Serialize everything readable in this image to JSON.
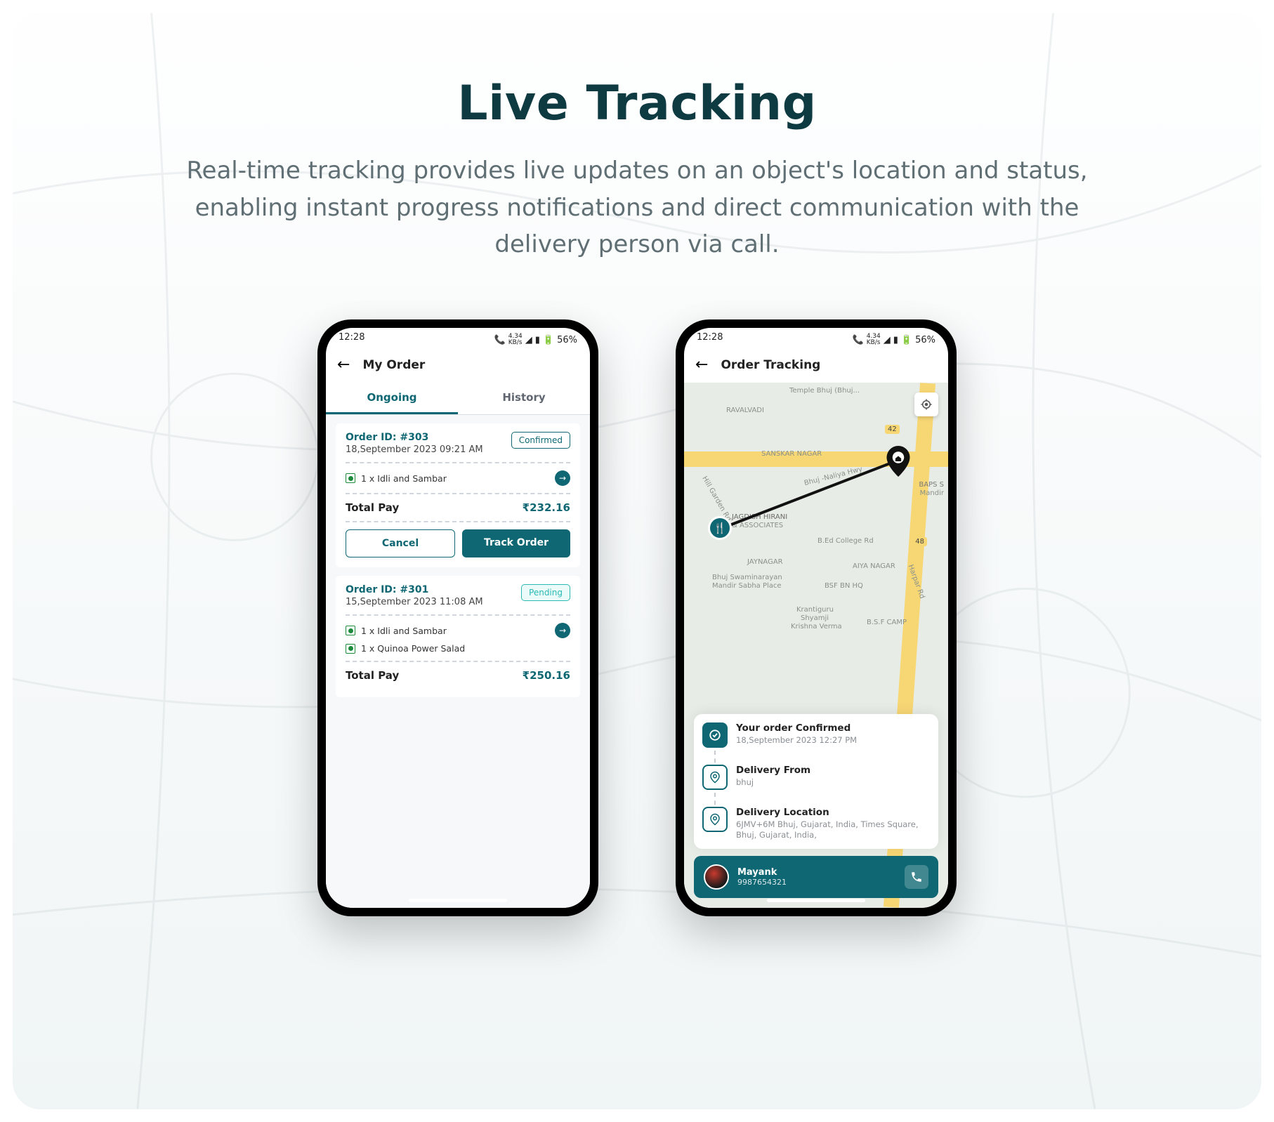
{
  "header": {
    "title": "Live Tracking",
    "subtitle": "Real-time tracking provides live updates on an object's location and status, enabling instant progress notifications and direct communication with the delivery person via call."
  },
  "status": {
    "time": "12:28",
    "net": "4.34",
    "net_unit": "KB/s",
    "battery": "56%"
  },
  "colors": {
    "teal": "#0E6773",
    "tealLight": "#29B8A8"
  },
  "phone1": {
    "screen_title": "My Order",
    "tabs": {
      "ongoing": "Ongoing",
      "history": "History"
    },
    "orders": [
      {
        "id": "Order ID: #303",
        "date": "18,September 2023 09:21 AM",
        "status": "Confirmed",
        "status_kind": "confirmed",
        "items": [
          {
            "qty": "1 x",
            "name": "Idli and Sambar",
            "has_arrow": true
          }
        ],
        "total_label": "Total Pay",
        "total": "₹232.16",
        "actions": {
          "cancel": "Cancel",
          "track": "Track Order"
        }
      },
      {
        "id": "Order ID: #301",
        "date": "15,September 2023 11:08 AM",
        "status": "Pending",
        "status_kind": "pending",
        "items": [
          {
            "qty": "1 x",
            "name": "Idli and Sambar",
            "has_arrow": true
          },
          {
            "qty": "1 x",
            "name": "Quinoa Power Salad",
            "has_arrow": false
          }
        ],
        "total_label": "Total Pay",
        "total": "₹250.16"
      }
    ]
  },
  "phone2": {
    "screen_title": "Order Tracking",
    "map_labels": [
      "Temple Bhuj (Bhuj...",
      "RAVALVADI",
      "SANSKAR NAGAR",
      "Bhuj -Naliya Hwy",
      "BAPS S",
      "Mandir",
      "Hill Garden Rd",
      "JAGDISH HIRANI",
      "& ASSOCIATES",
      "B.Ed College Rd",
      "JAYNAGAR",
      "AIYA NAGAR",
      "Bhuj Swaminarayan",
      "Mandir Sabha Place",
      "BSF BN HQ",
      "Harpar Rd",
      "Krantiguru",
      "Shyamji",
      "Krishna Verma",
      "B.S.F CAMP",
      "42",
      "48"
    ],
    "steps": [
      {
        "kind": "fill",
        "icon": "check",
        "title": "Your order Confirmed",
        "sub": "18,September 2023 12:27 PM"
      },
      {
        "kind": "out",
        "icon": "pin",
        "title": "Delivery From",
        "sub": "bhuj"
      },
      {
        "kind": "out",
        "icon": "pin",
        "title": "Delivery Location",
        "sub": "6JMV+6M Bhuj, Gujarat, India, Times Square, Bhuj, Gujarat, India,"
      }
    ],
    "driver": {
      "name": "Mayank",
      "phone": "9987654321"
    }
  }
}
